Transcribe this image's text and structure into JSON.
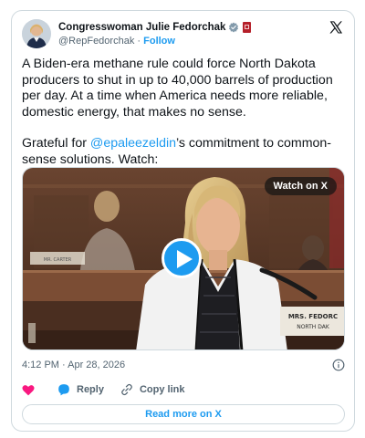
{
  "author": {
    "name": "Congresswoman Julie Fedorchak",
    "handle": "@RepFedorchak",
    "separator": "·",
    "follow_label": "Follow"
  },
  "tweet": {
    "paragraph1": "A Biden-era methane rule could force North Dakota producers to shut in up to 40,000 barrels of production per day. At a time when America needs more reliable, domestic energy, that makes no sense.",
    "p2_before": "Grateful for ",
    "p2_mention": "@epaleezeldin",
    "p2_after": "’s commitment to common-sense solutions. Watch:"
  },
  "media": {
    "watch_label": "Watch on X",
    "nameplate_line1": "MRS. FEDORC",
    "nameplate_line2": "NORTH DAK",
    "background_nameplate": "MR. CARTER"
  },
  "meta": {
    "timestamp": "4:12 PM · Apr 28, 2026"
  },
  "actions": {
    "reply_label": "Reply",
    "copy_link_label": "Copy link"
  },
  "read_more_label": "Read more on X",
  "colors": {
    "accent": "#1d9bf0",
    "like": "#f91880",
    "text": "#0f1419",
    "muted": "#536471",
    "border": "#cfd9de"
  },
  "icons": {
    "verified": "verified-badge-icon",
    "flag": "state-flag-icon",
    "brand": "x-logo-icon",
    "play": "play-icon",
    "info": "info-icon",
    "like": "heart-icon",
    "reply": "speech-bubble-icon",
    "copy": "link-icon"
  }
}
